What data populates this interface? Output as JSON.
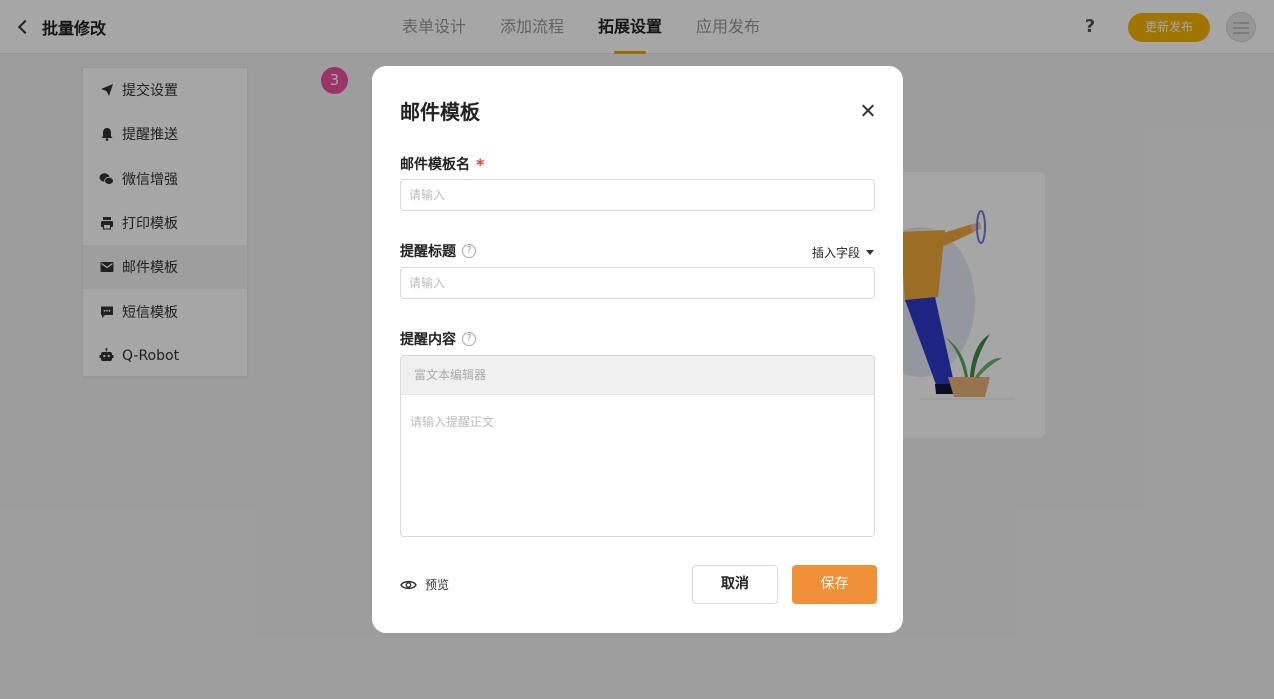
{
  "header": {
    "back_label": "批量修改",
    "tabs": [
      {
        "label": "表单设计"
      },
      {
        "label": "添加流程"
      },
      {
        "label": "拓展设置"
      },
      {
        "label": "应用发布"
      }
    ],
    "active_tab": "拓展设置",
    "help_label": "?",
    "publish_label": "更新发布"
  },
  "sidebar": {
    "items": [
      {
        "label": "提交设置",
        "icon": "send-icon"
      },
      {
        "label": "提醒推送",
        "icon": "bell-icon"
      },
      {
        "label": "微信增强",
        "icon": "wechat-icon"
      },
      {
        "label": "打印模板",
        "icon": "printer-icon"
      },
      {
        "label": "邮件模板",
        "icon": "mail-icon"
      },
      {
        "label": "短信模板",
        "icon": "sms-icon"
      },
      {
        "label": "Q-Robot",
        "icon": "robot-icon"
      }
    ],
    "active_item": "邮件模板"
  },
  "step_badge": "3",
  "modal": {
    "title": "邮件模板",
    "template_name_label": "邮件模板名",
    "required_mark": "*",
    "template_name_placeholder": "请输入",
    "subject_label": "提醒标题",
    "subject_placeholder": "请输入",
    "help_mark": "?",
    "insert_field_label": "插入字段",
    "content_label": "提醒内容",
    "editor_toolbar_placeholder": "富文本编辑器",
    "content_placeholder": "请输入提醒正文",
    "preview_label": "预览",
    "cancel_label": "取消",
    "save_label": "保存"
  },
  "colors": {
    "accent": "#f5b400",
    "save_button": "#f0913a",
    "step_badge": "#ee4fa4",
    "required": "#e23c3c"
  }
}
